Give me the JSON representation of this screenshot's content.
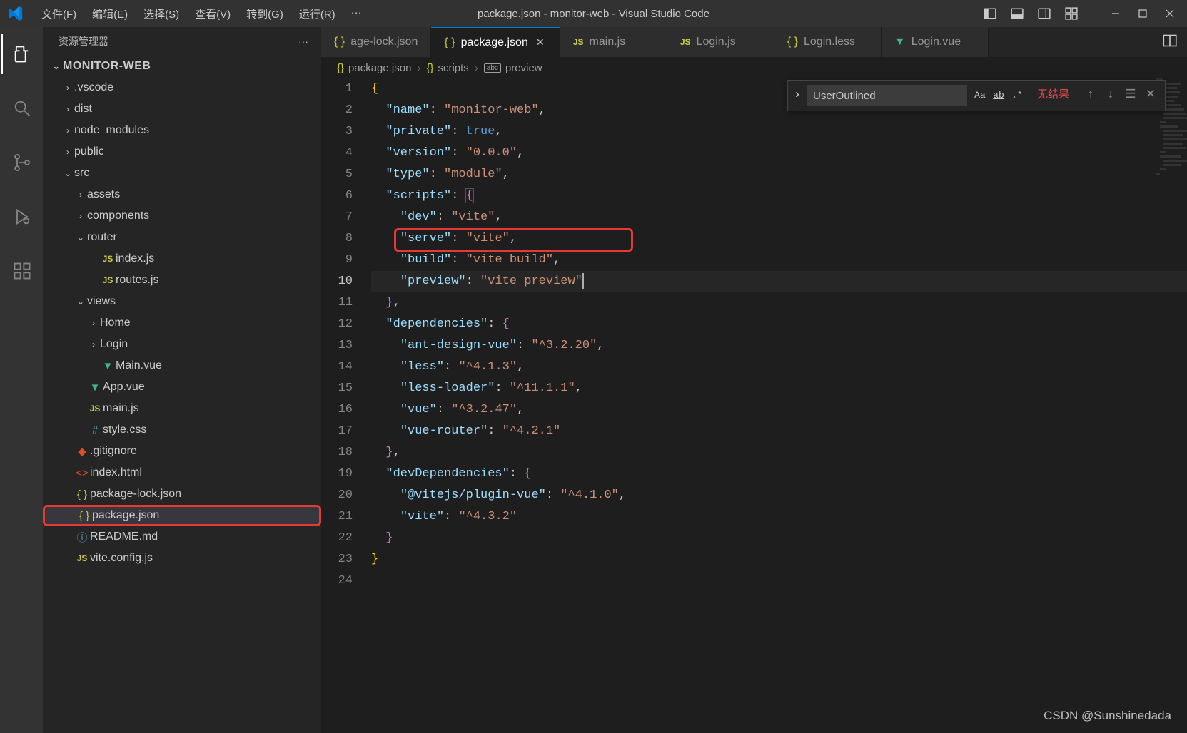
{
  "titlebar": {
    "menus": [
      "文件(F)",
      "编辑(E)",
      "选择(S)",
      "查看(V)",
      "转到(G)",
      "运行(R)",
      "···"
    ],
    "title": "package.json - monitor-web - Visual Studio Code"
  },
  "sidebar": {
    "header": "资源管理器",
    "root": "MONITOR-WEB",
    "tree": [
      {
        "indent": 1,
        "chev": "›",
        "label": ".vscode",
        "kind": "folder"
      },
      {
        "indent": 1,
        "chev": "›",
        "label": "dist",
        "kind": "folder"
      },
      {
        "indent": 1,
        "chev": "›",
        "label": "node_modules",
        "kind": "folder"
      },
      {
        "indent": 1,
        "chev": "›",
        "label": "public",
        "kind": "folder"
      },
      {
        "indent": 1,
        "chev": "⌄",
        "label": "src",
        "kind": "folder"
      },
      {
        "indent": 2,
        "chev": "›",
        "label": "assets",
        "kind": "folder"
      },
      {
        "indent": 2,
        "chev": "›",
        "label": "components",
        "kind": "folder"
      },
      {
        "indent": 2,
        "chev": "⌄",
        "label": "router",
        "kind": "folder"
      },
      {
        "indent": 3,
        "chev": "",
        "label": "index.js",
        "kind": "js"
      },
      {
        "indent": 3,
        "chev": "",
        "label": "routes.js",
        "kind": "js"
      },
      {
        "indent": 2,
        "chev": "⌄",
        "label": "views",
        "kind": "folder"
      },
      {
        "indent": 3,
        "chev": "›",
        "label": "Home",
        "kind": "folder"
      },
      {
        "indent": 3,
        "chev": "›",
        "label": "Login",
        "kind": "folder"
      },
      {
        "indent": 3,
        "chev": "",
        "label": "Main.vue",
        "kind": "vue"
      },
      {
        "indent": 2,
        "chev": "",
        "label": "App.vue",
        "kind": "vue"
      },
      {
        "indent": 2,
        "chev": "",
        "label": "main.js",
        "kind": "js"
      },
      {
        "indent": 2,
        "chev": "",
        "label": "style.css",
        "kind": "css"
      },
      {
        "indent": 1,
        "chev": "",
        "label": ".gitignore",
        "kind": "git"
      },
      {
        "indent": 1,
        "chev": "",
        "label": "index.html",
        "kind": "html"
      },
      {
        "indent": 1,
        "chev": "",
        "label": "package-lock.json",
        "kind": "json"
      },
      {
        "indent": 1,
        "chev": "",
        "label": "package.json",
        "kind": "json",
        "selected": true,
        "hl": true
      },
      {
        "indent": 1,
        "chev": "",
        "label": "README.md",
        "kind": "md"
      },
      {
        "indent": 1,
        "chev": "",
        "label": "vite.config.js",
        "kind": "js"
      }
    ]
  },
  "tabs": [
    {
      "label": "age-lock.json",
      "kind": "json",
      "truncated": true
    },
    {
      "label": "package.json",
      "kind": "json",
      "active": true
    },
    {
      "label": "main.js",
      "kind": "js"
    },
    {
      "label": "Login.js",
      "kind": "js"
    },
    {
      "label": "Login.less",
      "kind": "json"
    },
    {
      "label": "Login.vue",
      "kind": "vue"
    }
  ],
  "breadcrumbs": [
    {
      "icon": "{}",
      "label": "package.json"
    },
    {
      "icon": "{}",
      "label": "scripts"
    },
    {
      "icon": "abc",
      "label": "preview"
    }
  ],
  "search": {
    "value": "UserOutlined",
    "results": "无结果"
  },
  "code": {
    "package": {
      "name": "monitor-web",
      "private": true,
      "version": "0.0.0",
      "type": "module",
      "scripts": {
        "dev": "vite",
        "serve": "vite",
        "build": "vite build",
        "preview": "vite preview"
      },
      "dependencies": {
        "ant-design-vue": "^3.2.20",
        "less": "^4.1.3",
        "less-loader": "^11.1.1",
        "vue": "^3.2.47",
        "vue-router": "^4.2.1"
      },
      "devDependencies": {
        "@vitejs/plugin-vue": "^4.1.0",
        "vite": "^4.3.2"
      }
    },
    "current_line": 10
  },
  "watermark": "CSDN @Sunshinedada"
}
